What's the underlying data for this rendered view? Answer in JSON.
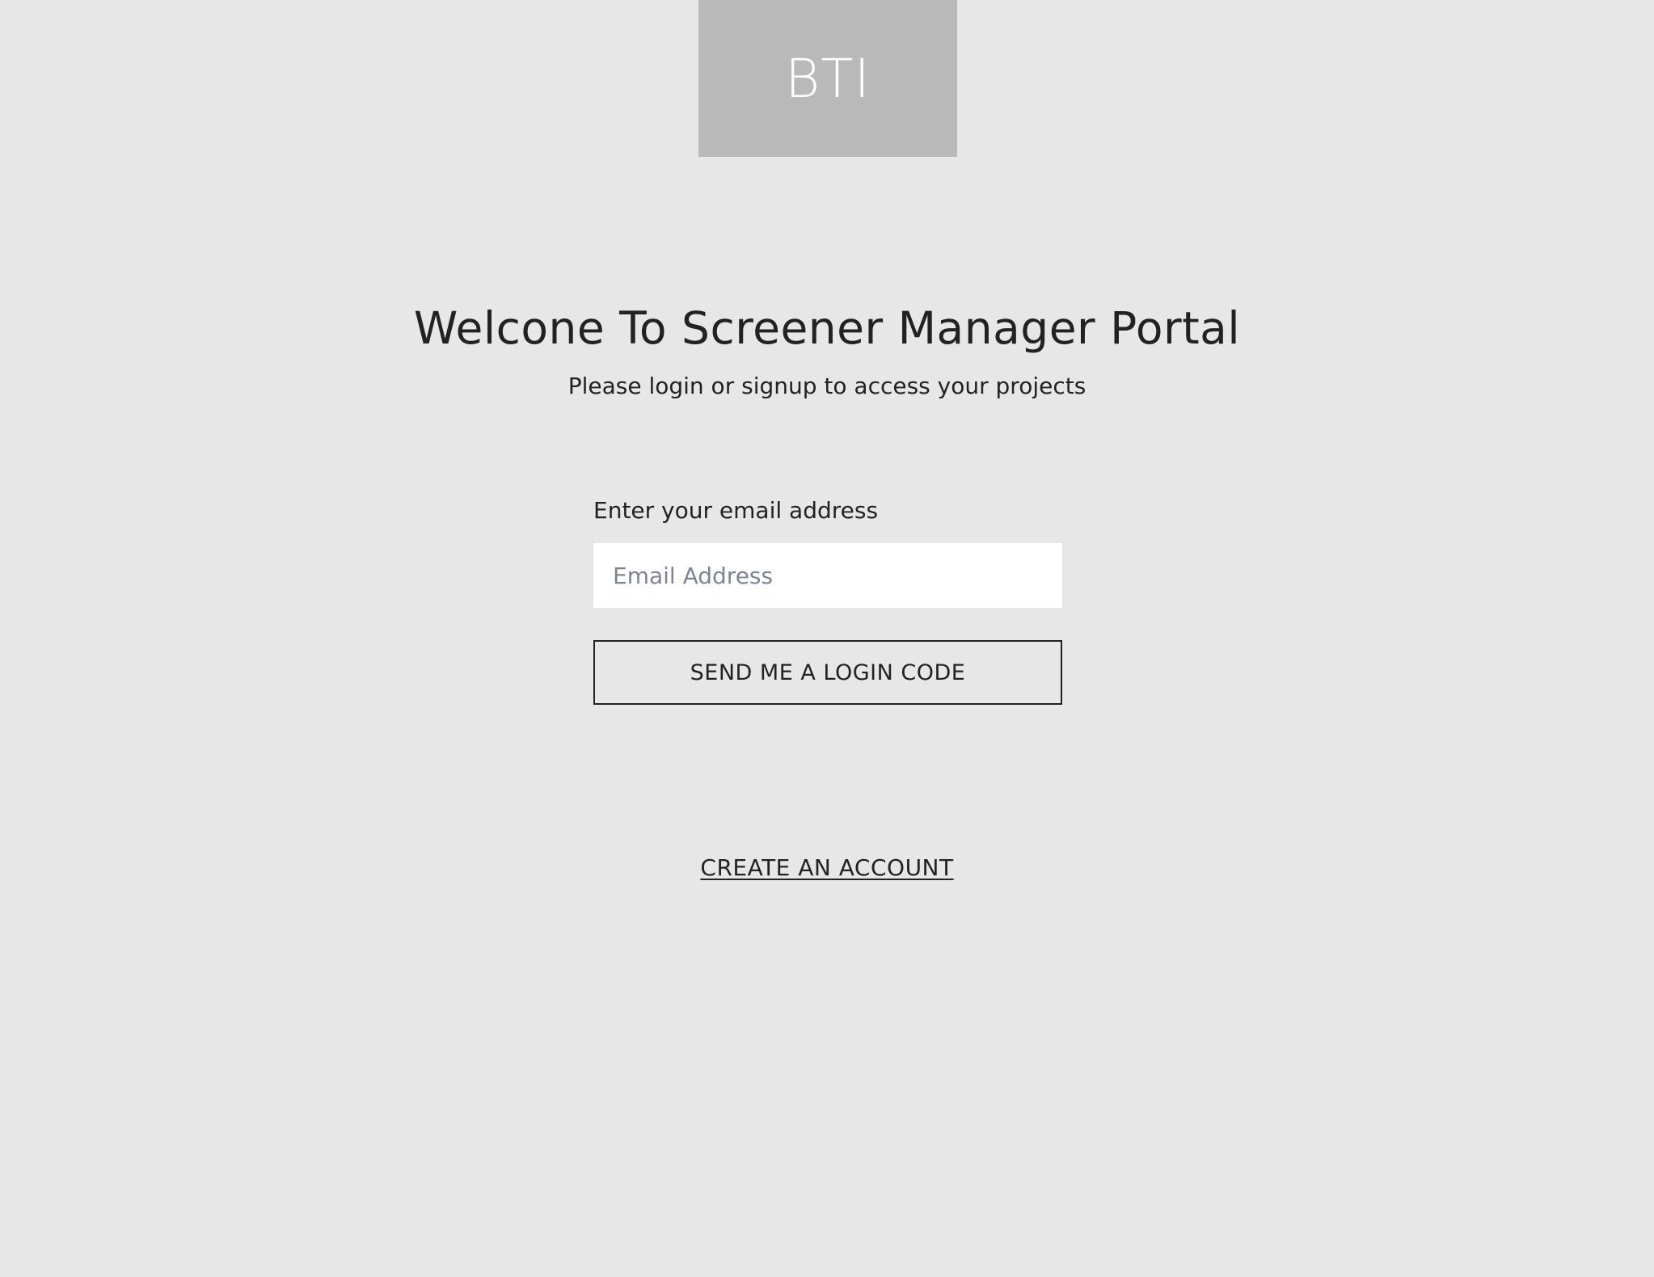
{
  "logo": {
    "text": "BTI"
  },
  "header": {
    "title": "Welcone To Screener Manager Portal",
    "subtitle": "Please login or signup to access your projects"
  },
  "login_form": {
    "email_label": "Enter your email address",
    "email_value": "",
    "email_placeholder": "Email Address",
    "submit_label": "SEND ME A LOGIN CODE"
  },
  "footer": {
    "create_account_label": "CREATE AN ACCOUNT"
  },
  "colors": {
    "background": "#e7e7e7",
    "logo_background": "#b9b9b9",
    "text": "#222222",
    "placeholder": "#7c8590"
  }
}
